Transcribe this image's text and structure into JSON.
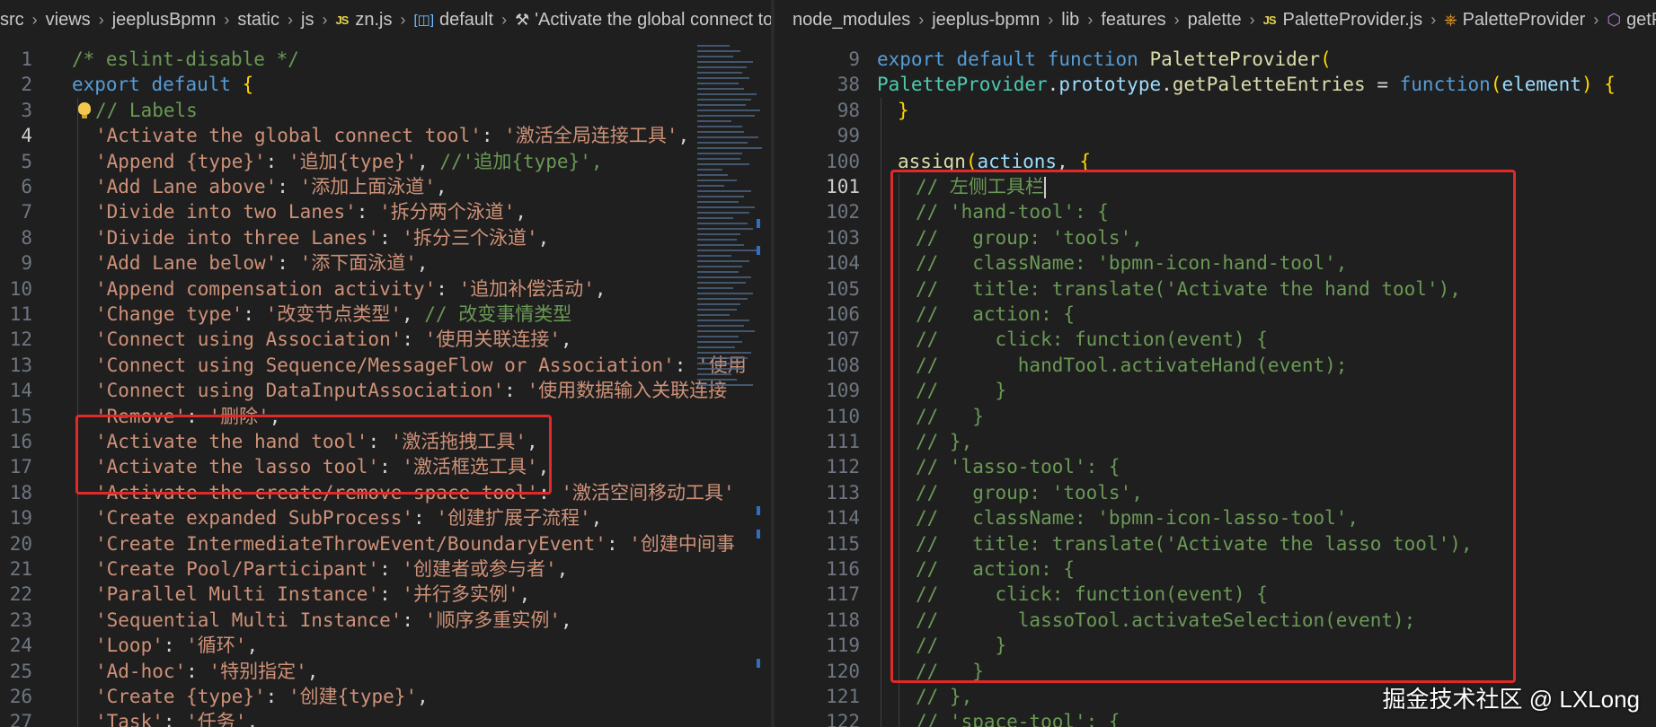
{
  "left": {
    "breadcrumb": [
      {
        "label": "src",
        "icon": ""
      },
      {
        "label": "views",
        "icon": ""
      },
      {
        "label": "jeeplusBpmn",
        "icon": ""
      },
      {
        "label": "static",
        "icon": ""
      },
      {
        "label": "js",
        "icon": ""
      },
      {
        "label": "zn.js",
        "icon": "js-file-icon"
      },
      {
        "label": "default",
        "icon": "brackets-icon"
      },
      {
        "label": "'Activate the global connect to",
        "icon": "wrench-icon"
      }
    ],
    "lines": [
      {
        "n": "1",
        "tokens": [
          [
            "cm",
            "/* eslint-disable */"
          ]
        ]
      },
      {
        "n": "2",
        "tokens": [
          [
            "kw",
            "export "
          ],
          [
            "kw",
            "default "
          ],
          [
            "br",
            "{"
          ]
        ]
      },
      {
        "n": "3",
        "tokens": [
          [
            "cm",
            "// Labels"
          ]
        ]
      },
      {
        "n": "4",
        "tokens": [
          [
            "str",
            "'Activate the global connect tool'"
          ],
          [
            "p",
            ": "
          ],
          [
            "str",
            "'激活全局连接工具'"
          ],
          [
            "p",
            ","
          ]
        ]
      },
      {
        "n": "5",
        "tokens": [
          [
            "str",
            "'Append {type}'"
          ],
          [
            "p",
            ": "
          ],
          [
            "str",
            "'追加{type}'"
          ],
          [
            "p",
            ", "
          ],
          [
            "cm",
            "//'追加{type}',"
          ]
        ]
      },
      {
        "n": "6",
        "tokens": [
          [
            "str",
            "'Add Lane above'"
          ],
          [
            "p",
            ": "
          ],
          [
            "str",
            "'添加上面泳道'"
          ],
          [
            "p",
            ","
          ]
        ]
      },
      {
        "n": "7",
        "tokens": [
          [
            "str",
            "'Divide into two Lanes'"
          ],
          [
            "p",
            ": "
          ],
          [
            "str",
            "'拆分两个泳道'"
          ],
          [
            "p",
            ","
          ]
        ]
      },
      {
        "n": "8",
        "tokens": [
          [
            "str",
            "'Divide into three Lanes'"
          ],
          [
            "p",
            ": "
          ],
          [
            "str",
            "'拆分三个泳道'"
          ],
          [
            "p",
            ","
          ]
        ]
      },
      {
        "n": "9",
        "tokens": [
          [
            "str",
            "'Add Lane below'"
          ],
          [
            "p",
            ": "
          ],
          [
            "str",
            "'添下面泳道'"
          ],
          [
            "p",
            ","
          ]
        ]
      },
      {
        "n": "10",
        "tokens": [
          [
            "str",
            "'Append compensation activity'"
          ],
          [
            "p",
            ": "
          ],
          [
            "str",
            "'追加补偿活动'"
          ],
          [
            "p",
            ","
          ]
        ]
      },
      {
        "n": "11",
        "tokens": [
          [
            "str",
            "'Change type'"
          ],
          [
            "p",
            ": "
          ],
          [
            "str",
            "'改变节点类型'"
          ],
          [
            "p",
            ", "
          ],
          [
            "cm",
            "// 改变事情类型"
          ]
        ]
      },
      {
        "n": "12",
        "tokens": [
          [
            "str",
            "'Connect using Association'"
          ],
          [
            "p",
            ": "
          ],
          [
            "str",
            "'使用关联连接'"
          ],
          [
            "p",
            ","
          ]
        ]
      },
      {
        "n": "13",
        "tokens": [
          [
            "str",
            "'Connect using Sequence/MessageFlow or Association'"
          ],
          [
            "p",
            ": "
          ],
          [
            "str",
            "'使用"
          ]
        ]
      },
      {
        "n": "14",
        "tokens": [
          [
            "str",
            "'Connect using DataInputAssociation'"
          ],
          [
            "p",
            ": "
          ],
          [
            "str",
            "'使用数据输入关联连接"
          ]
        ]
      },
      {
        "n": "15",
        "tokens": [
          [
            "str",
            "'Remove'"
          ],
          [
            "p",
            ": "
          ],
          [
            "str",
            "'删除'"
          ],
          [
            "p",
            ","
          ]
        ]
      },
      {
        "n": "16",
        "tokens": [
          [
            "str",
            "'Activate the hand tool'"
          ],
          [
            "p",
            ": "
          ],
          [
            "str",
            "'激活拖拽工具'"
          ],
          [
            "p",
            ","
          ]
        ]
      },
      {
        "n": "17",
        "tokens": [
          [
            "str",
            "'Activate the lasso tool'"
          ],
          [
            "p",
            ": "
          ],
          [
            "str",
            "'激活框选工具'"
          ],
          [
            "p",
            ","
          ]
        ]
      },
      {
        "n": "18",
        "tokens": [
          [
            "str",
            "'Activate the create/remove space tool'"
          ],
          [
            "p",
            ": "
          ],
          [
            "str",
            "'激活空间移动工具'"
          ]
        ]
      },
      {
        "n": "19",
        "tokens": [
          [
            "str",
            "'Create expanded SubProcess'"
          ],
          [
            "p",
            ": "
          ],
          [
            "str",
            "'创建扩展子流程'"
          ],
          [
            "p",
            ","
          ]
        ]
      },
      {
        "n": "20",
        "tokens": [
          [
            "str",
            "'Create IntermediateThrowEvent/BoundaryEvent'"
          ],
          [
            "p",
            ": "
          ],
          [
            "str",
            "'创建中间事"
          ]
        ]
      },
      {
        "n": "21",
        "tokens": [
          [
            "str",
            "'Create Pool/Participant'"
          ],
          [
            "p",
            ": "
          ],
          [
            "str",
            "'创建者或参与者'"
          ],
          [
            "p",
            ","
          ]
        ]
      },
      {
        "n": "22",
        "tokens": [
          [
            "str",
            "'Parallel Multi Instance'"
          ],
          [
            "p",
            ": "
          ],
          [
            "str",
            "'并行多实例'"
          ],
          [
            "p",
            ","
          ]
        ]
      },
      {
        "n": "23",
        "tokens": [
          [
            "str",
            "'Sequential Multi Instance'"
          ],
          [
            "p",
            ": "
          ],
          [
            "str",
            "'顺序多重实例'"
          ],
          [
            "p",
            ","
          ]
        ]
      },
      {
        "n": "24",
        "tokens": [
          [
            "str",
            "'Loop'"
          ],
          [
            "p",
            ": "
          ],
          [
            "str",
            "'循环'"
          ],
          [
            "p",
            ","
          ]
        ]
      },
      {
        "n": "25",
        "tokens": [
          [
            "str",
            "'Ad-hoc'"
          ],
          [
            "p",
            ": "
          ],
          [
            "str",
            "'特别指定'"
          ],
          [
            "p",
            ","
          ]
        ]
      },
      {
        "n": "26",
        "tokens": [
          [
            "str",
            "'Create {type}'"
          ],
          [
            "p",
            ": "
          ],
          [
            "str",
            "'创建{type}'"
          ],
          [
            "p",
            ","
          ]
        ]
      },
      {
        "n": "27",
        "tokens": [
          [
            "str",
            "'Task'"
          ],
          [
            "p",
            ": "
          ],
          [
            "str",
            "'任务'"
          ],
          [
            "p",
            ","
          ]
        ]
      }
    ],
    "active_line": "4"
  },
  "right": {
    "breadcrumb": [
      {
        "label": "node_modules",
        "icon": ""
      },
      {
        "label": "jeeplus-bpmn",
        "icon": ""
      },
      {
        "label": "lib",
        "icon": ""
      },
      {
        "label": "features",
        "icon": ""
      },
      {
        "label": "palette",
        "icon": ""
      },
      {
        "label": "PaletteProvider.js",
        "icon": "js-file-icon"
      },
      {
        "label": "PaletteProvider",
        "icon": "class-icon"
      },
      {
        "label": "getP",
        "icon": "method-icon"
      }
    ],
    "lines": [
      {
        "n": "9",
        "tokens": [
          [
            "kw",
            "export "
          ],
          [
            "kw",
            "default "
          ],
          [
            "kw",
            "function "
          ],
          [
            "fn",
            "PaletteProvider"
          ],
          [
            "br",
            "("
          ]
        ]
      },
      {
        "n": "38",
        "tokens": [
          [
            "cls",
            "PaletteProvider"
          ],
          [
            "p",
            "."
          ],
          [
            "var",
            "prototype"
          ],
          [
            "p",
            "."
          ],
          [
            "fn",
            "getPaletteEntries"
          ],
          [
            "p",
            " = "
          ],
          [
            "kw",
            "function"
          ],
          [
            "br",
            "("
          ],
          [
            "var",
            "element"
          ],
          [
            "br",
            ")"
          ],
          [
            "p",
            " "
          ],
          [
            "br",
            "{"
          ]
        ]
      },
      {
        "n": "98",
        "tokens": [
          [
            "br",
            "}"
          ]
        ]
      },
      {
        "n": "99",
        "tokens": []
      },
      {
        "n": "100",
        "tokens": [
          [
            "fn",
            "assign"
          ],
          [
            "br",
            "("
          ],
          [
            "var",
            "actions"
          ],
          [
            "p",
            ", "
          ],
          [
            "br",
            "{"
          ]
        ]
      },
      {
        "n": "101",
        "tokens": [
          [
            "cm",
            "// 左侧工具栏"
          ]
        ]
      },
      {
        "n": "102",
        "tokens": [
          [
            "cm",
            "// 'hand-tool': {"
          ]
        ]
      },
      {
        "n": "103",
        "tokens": [
          [
            "cm",
            "//   group: 'tools',"
          ]
        ]
      },
      {
        "n": "104",
        "tokens": [
          [
            "cm",
            "//   className: 'bpmn-icon-hand-tool',"
          ]
        ]
      },
      {
        "n": "105",
        "tokens": [
          [
            "cm",
            "//   title: translate('Activate the hand tool'),"
          ]
        ]
      },
      {
        "n": "106",
        "tokens": [
          [
            "cm",
            "//   action: {"
          ]
        ]
      },
      {
        "n": "107",
        "tokens": [
          [
            "cm",
            "//     click: function(event) {"
          ]
        ]
      },
      {
        "n": "108",
        "tokens": [
          [
            "cm",
            "//       handTool.activateHand(event);"
          ]
        ]
      },
      {
        "n": "109",
        "tokens": [
          [
            "cm",
            "//     }"
          ]
        ]
      },
      {
        "n": "110",
        "tokens": [
          [
            "cm",
            "//   }"
          ]
        ]
      },
      {
        "n": "111",
        "tokens": [
          [
            "cm",
            "// },"
          ]
        ]
      },
      {
        "n": "112",
        "tokens": [
          [
            "cm",
            "// 'lasso-tool': {"
          ]
        ]
      },
      {
        "n": "113",
        "tokens": [
          [
            "cm",
            "//   group: 'tools',"
          ]
        ]
      },
      {
        "n": "114",
        "tokens": [
          [
            "cm",
            "//   className: 'bpmn-icon-lasso-tool',"
          ]
        ]
      },
      {
        "n": "115",
        "tokens": [
          [
            "cm",
            "//   title: translate('Activate the lasso tool'),"
          ]
        ]
      },
      {
        "n": "116",
        "tokens": [
          [
            "cm",
            "//   action: {"
          ]
        ]
      },
      {
        "n": "117",
        "tokens": [
          [
            "cm",
            "//     click: function(event) {"
          ]
        ]
      },
      {
        "n": "118",
        "tokens": [
          [
            "cm",
            "//       lassoTool.activateSelection(event);"
          ]
        ]
      },
      {
        "n": "119",
        "tokens": [
          [
            "cm",
            "//     }"
          ]
        ]
      },
      {
        "n": "120",
        "tokens": [
          [
            "cm",
            "//   }"
          ]
        ]
      },
      {
        "n": "121",
        "tokens": [
          [
            "cm",
            "// },"
          ]
        ]
      },
      {
        "n": "122",
        "tokens": [
          [
            "cm",
            "// 'space-tool': {"
          ]
        ]
      }
    ],
    "active_line": "101"
  },
  "watermark": "掘金技术社区 @ LXLong",
  "colors": {
    "background": "#1f1f1f",
    "highlight_box": "#e02a2a",
    "comment": "#6a9955",
    "string": "#ce9178",
    "keyword": "#569cd6"
  }
}
